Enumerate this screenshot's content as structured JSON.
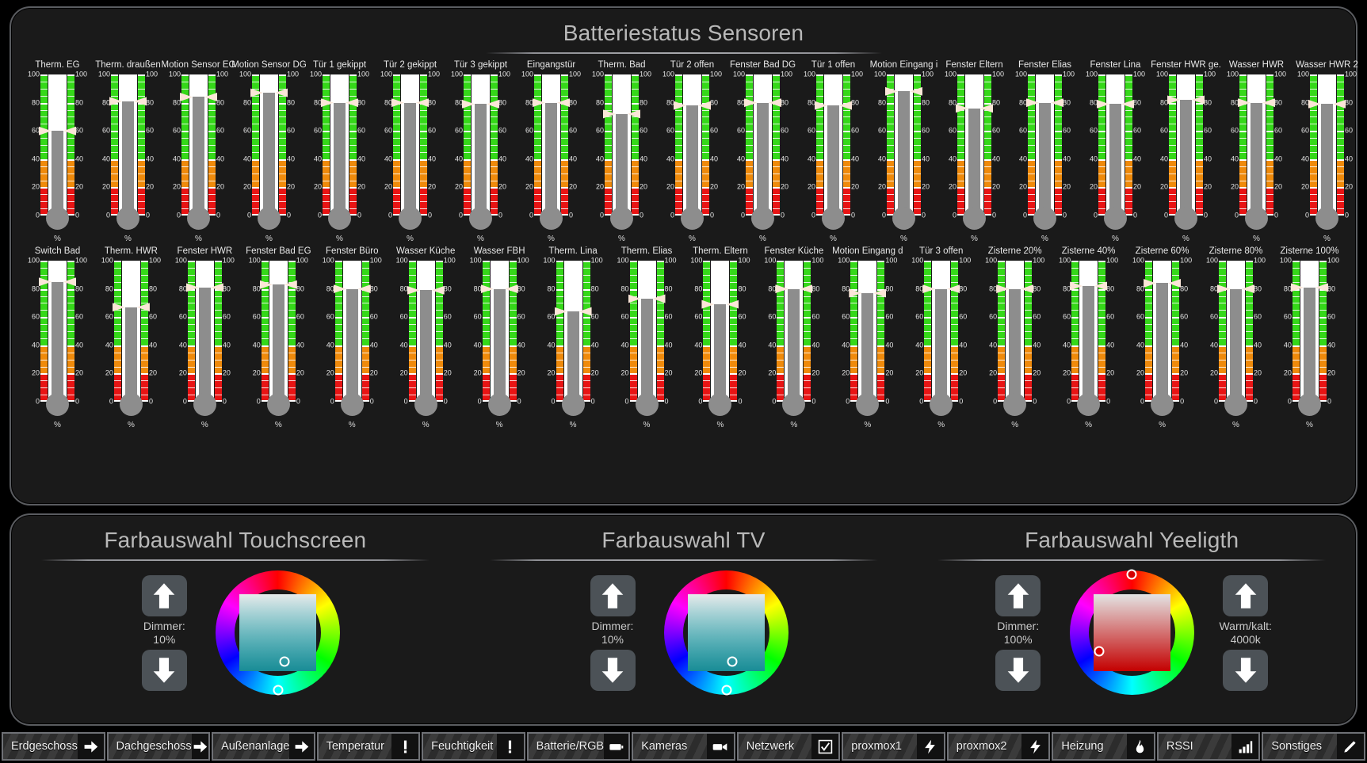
{
  "battery_panel": {
    "title": "Batteriestatus Sensoren",
    "unit": "%",
    "scale_ticks": [
      "100",
      "80",
      "60",
      "40",
      "20",
      "0"
    ],
    "row1": [
      {
        "label": "Therm. EG",
        "value": 60
      },
      {
        "label": "Therm. draußen",
        "value": 81
      },
      {
        "label": "Motion Sensor EG",
        "value": 84
      },
      {
        "label": "Motion Sensor DG",
        "value": 87
      },
      {
        "label": "Tür 1 gekippt",
        "value": 80
      },
      {
        "label": "Tür 2 gekippt",
        "value": 80
      },
      {
        "label": "Tür 3 gekippt",
        "value": 79
      },
      {
        "label": "Eingangstür",
        "value": 80
      },
      {
        "label": "Therm. Bad",
        "value": 72
      },
      {
        "label": "Tür 2 offen",
        "value": 78
      },
      {
        "label": "Fenster Bad DG",
        "value": 80
      },
      {
        "label": "Tür 1 offen",
        "value": 78
      },
      {
        "label": "Motion Eingang i",
        "value": 88
      },
      {
        "label": "Fenster Eltern",
        "value": 76
      },
      {
        "label": "Fenster Elias",
        "value": 80
      },
      {
        "label": "Fenster Lina",
        "value": 79
      },
      {
        "label": "Fenster HWR ge.",
        "value": 82
      },
      {
        "label": "Wasser HWR",
        "value": 80
      },
      {
        "label": "Wasser HWR 2",
        "value": 79
      }
    ],
    "row2": [
      {
        "label": "Switch Bad",
        "value": 85
      },
      {
        "label": "Therm. HWR",
        "value": 67
      },
      {
        "label": "Fenster HWR",
        "value": 81
      },
      {
        "label": "Fenster Bad EG",
        "value": 83
      },
      {
        "label": "Fenster Büro",
        "value": 80
      },
      {
        "label": "Wasser Küche",
        "value": 79
      },
      {
        "label": "Wasser FBH",
        "value": 80
      },
      {
        "label": "Therm. Lina",
        "value": 64
      },
      {
        "label": "Therm. Elias",
        "value": 73
      },
      {
        "label": "Therm. Eltern",
        "value": 69
      },
      {
        "label": "Fenster Küche",
        "value": 80
      },
      {
        "label": "Motion Eingang d",
        "value": 77
      },
      {
        "label": "Tür 3 offen",
        "value": 80
      },
      {
        "label": "Zisterne 20%",
        "value": 80
      },
      {
        "label": "Zisterne 40%",
        "value": 82
      },
      {
        "label": "Zisterne 60%",
        "value": 84
      },
      {
        "label": "Zisterne 80%",
        "value": 80
      },
      {
        "label": "Zisterne 100%",
        "value": 81
      }
    ]
  },
  "color_section": {
    "touchscreen": {
      "title": "Farbauswahl Touchscreen",
      "dimmer_label": "Dimmer:",
      "dimmer_value": "10%",
      "up_icon": "arrow-up-icon",
      "down_icon": "arrow-down-icon"
    },
    "tv": {
      "title": "Farbauswahl TV",
      "dimmer_label": "Dimmer:",
      "dimmer_value": "10%",
      "up_icon": "arrow-up-icon",
      "down_icon": "arrow-down-icon"
    },
    "yeelight": {
      "title": "Farbauswahl Yeeligth",
      "dimmer_label": "Dimmer:",
      "dimmer_value": "100%",
      "temp_label": "Warm/kalt:",
      "temp_value": "4000k",
      "up_icon": "arrow-up-icon",
      "down_icon": "arrow-down-icon"
    }
  },
  "taskbar": {
    "items": [
      {
        "label": "Erdgeschoss",
        "icon": "arrow-right-icon"
      },
      {
        "label": "Dachgeschoss",
        "icon": "arrow-right-icon"
      },
      {
        "label": "Außenanlage",
        "icon": "arrow-right-icon"
      },
      {
        "label": "Temperatur",
        "icon": "thermometer-icon"
      },
      {
        "label": "Feuchtigkeit",
        "icon": "thermometer-icon"
      },
      {
        "label": "Batterie/RGB",
        "icon": "battery-icon"
      },
      {
        "label": "Kameras",
        "icon": "video-camera-icon"
      },
      {
        "label": "Netzwerk",
        "icon": "checkbox-icon"
      },
      {
        "label": "proxmox1",
        "icon": "lightning-icon"
      },
      {
        "label": "proxmox2",
        "icon": "lightning-icon"
      },
      {
        "label": "Heizung",
        "icon": "flame-icon"
      },
      {
        "label": "RSSI",
        "icon": "signal-icon"
      },
      {
        "label": "Sonstiges",
        "icon": "pencil-icon"
      }
    ]
  },
  "colors": {
    "panel_bg": "#1a1a1a",
    "panel_border": "#5a5c60",
    "band_green": "#35d819",
    "band_orange": "#ef8a0b",
    "band_red": "#e81414",
    "mercury": "#8d8d8d",
    "title_text": "#b9b9b9"
  }
}
